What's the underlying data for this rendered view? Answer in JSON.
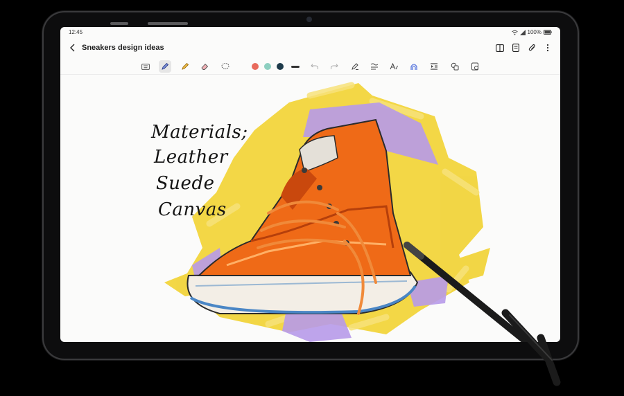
{
  "status": {
    "time": "12:45",
    "battery": "100%"
  },
  "note": {
    "title": "Sneakers design ideas"
  },
  "toolbar": {
    "colors": [
      "#e86a5c",
      "#8dcfc0",
      "#1d3a4a"
    ],
    "tools": [
      "keyboard-icon",
      "pen-icon",
      "highlighter-icon",
      "eraser-icon",
      "lasso-icon",
      "undo-icon",
      "redo-icon",
      "pen-settings-icon",
      "text-straighten-icon",
      "text-format-icon",
      "ai-brush-icon",
      "reading-mode-icon",
      "shapes-icon",
      "more-tools-icon"
    ]
  },
  "handwriting": {
    "line1": "Materials;",
    "line2": "Leather",
    "line3": "Suede",
    "line4": "Canvas"
  },
  "colors": {
    "screen": "#fbfbfa",
    "device": "#0d0d0e",
    "shoe_orange": "#ef6a17",
    "splash_yellow": "#f2d53c",
    "splash_purple": "#b79ae9"
  }
}
